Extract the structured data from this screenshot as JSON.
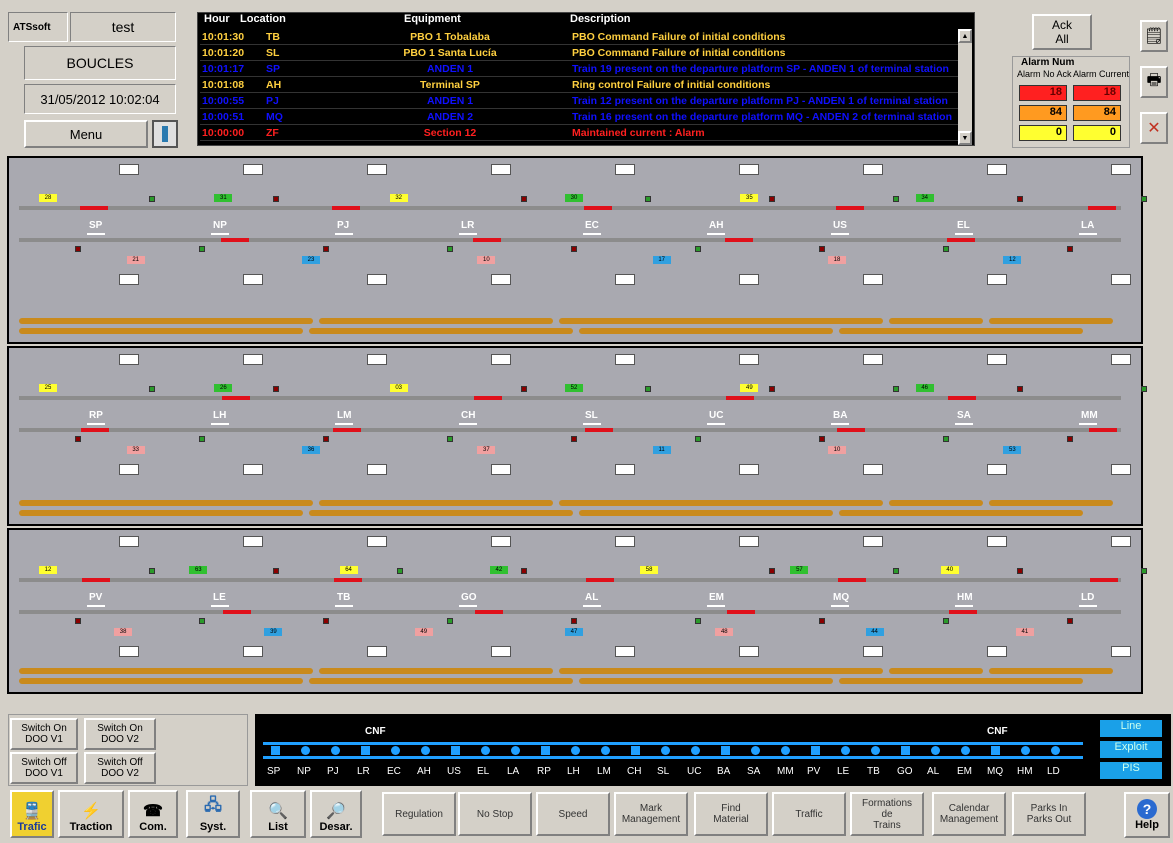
{
  "header": {
    "brand": "ATSsoft",
    "user": "test",
    "mode": "BOUCLES",
    "datetime": "31/05/2012 10:02:04",
    "menu": "Menu"
  },
  "alarm_table": {
    "columns": [
      "Hour",
      "Location",
      "Equipment",
      "Description"
    ],
    "rows": [
      {
        "hour": "10:01:30",
        "loc": "TB",
        "equip": "PBO 1 Tobalaba",
        "desc": "PBO Command Failure of initial conditions",
        "color": "#ffd040"
      },
      {
        "hour": "10:01:20",
        "loc": "SL",
        "equip": "PBO 1 Santa Lucía",
        "desc": "PBO Command Failure of initial conditions",
        "color": "#ffd040"
      },
      {
        "hour": "10:01:17",
        "loc": "SP",
        "equip": "ANDEN 1",
        "desc": "Train 19 present on the departure platform SP - ANDEN 1 of terminal station",
        "color": "#1010ff"
      },
      {
        "hour": "10:01:08",
        "loc": "AH",
        "equip": "Terminal SP",
        "desc": "Ring control Failure of initial conditions",
        "color": "#ffd040"
      },
      {
        "hour": "10:00:55",
        "loc": "PJ",
        "equip": "ANDEN 1",
        "desc": "Train 12 present on the departure platform PJ - ANDEN 1 of terminal station",
        "color": "#1010ff"
      },
      {
        "hour": "10:00:51",
        "loc": "MQ",
        "equip": "ANDEN 2",
        "desc": "Train 16 present on the departure platform MQ - ANDEN 2 of terminal station",
        "color": "#1010ff"
      },
      {
        "hour": "10:00:00",
        "loc": "ZF",
        "equip": "Section 12",
        "desc": "Maintained current : Alarm",
        "color": "#ff2020"
      }
    ]
  },
  "ack": {
    "line1": "Ack",
    "line2": "All"
  },
  "alarm_num": {
    "title": "Alarm Num",
    "col1": "Alarm No Ack",
    "col2": "Alarm Current",
    "red": [
      "18",
      "18"
    ],
    "orange": [
      "84",
      "84"
    ],
    "yellow": [
      "0",
      "0"
    ]
  },
  "panel1": {
    "stations": [
      "SP",
      "NP",
      "PJ",
      "LR",
      "EC",
      "AH",
      "US",
      "EL",
      "LA"
    ],
    "tags": [
      "28",
      "21",
      "31",
      "23",
      "32",
      "10",
      "30",
      "17",
      "35",
      "18",
      "34",
      "12"
    ]
  },
  "panel2": {
    "stations": [
      "RP",
      "LH",
      "LM",
      "CH",
      "SL",
      "UC",
      "BA",
      "SA",
      "MM"
    ],
    "tags": [
      "25",
      "33",
      "26",
      "36",
      "03",
      "37",
      "52",
      "11",
      "49",
      "10",
      "46",
      "53"
    ]
  },
  "panel3": {
    "stations": [
      "PV",
      "LE",
      "TB",
      "GO",
      "AL",
      "EM",
      "MQ",
      "HM",
      "LD"
    ],
    "tags": [
      "12",
      "38",
      "63",
      "39",
      "64",
      "49",
      "42",
      "47",
      "58",
      "48",
      "57",
      "44",
      "40",
      "41"
    ]
  },
  "switch_buttons": [
    "Switch On DOO V1",
    "Switch On DOO V2",
    "Switch Off DOO V1",
    "Switch Off DOO V2"
  ],
  "line_map": {
    "cnf": "CNF",
    "stations": [
      "SP",
      "NP",
      "PJ",
      "LR",
      "EC",
      "AH",
      "US",
      "EL",
      "LA",
      "RP",
      "LH",
      "LM",
      "CH",
      "SL",
      "UC",
      "BA",
      "SA",
      "MM",
      "PV",
      "LE",
      "TB",
      "GO",
      "AL",
      "EM",
      "MQ",
      "HM",
      "LD"
    ]
  },
  "view_buttons": [
    "Line",
    "Exploit",
    "PIS"
  ],
  "toolbar": [
    "Trafic",
    "Traction",
    "Com.",
    "Syst.",
    "List",
    "Desar."
  ],
  "function_buttons": [
    [
      "Regulation"
    ],
    [
      "No Stop"
    ],
    [
      "Speed"
    ],
    [
      "Mark",
      "Management"
    ],
    [
      "Find",
      "Material"
    ],
    [
      "Traffic"
    ],
    [
      "Formations",
      "de",
      "Trains"
    ],
    [
      "Calendar",
      "Management"
    ],
    [
      "Parks In",
      "Parks Out"
    ]
  ],
  "help": "Help"
}
